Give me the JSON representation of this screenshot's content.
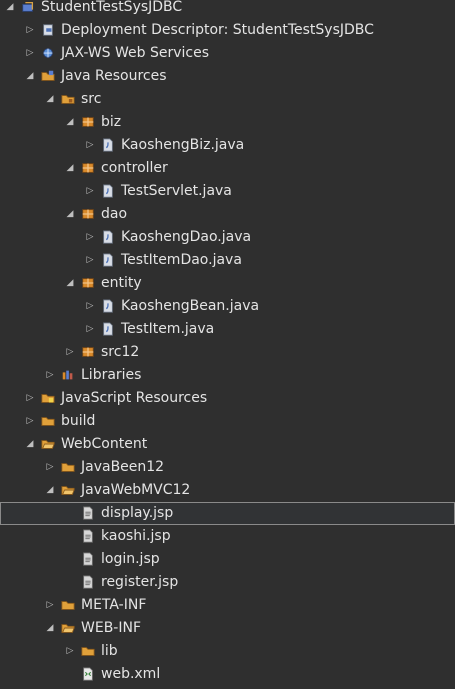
{
  "colors": {
    "background": "#2f2f2f",
    "text": "#e4e4e4",
    "selection_border": "#8a8a8a",
    "folder": "#e0a03a",
    "package": "#d98a2b",
    "java_file": "#d8dde6",
    "jsp_file": "#d7d7d7",
    "xml_file": "#e9e9e9"
  },
  "project_tree": {
    "items": [
      {
        "label": "StudentTestSysJDBC",
        "level": 0,
        "state": "expanded",
        "icon": "project-icon"
      },
      {
        "label": "Deployment Descriptor: StudentTestSysJDBC",
        "level": 1,
        "state": "collapsed",
        "icon": "deployment-descriptor-icon"
      },
      {
        "label": "JAX-WS Web Services",
        "level": 1,
        "state": "collapsed",
        "icon": "web-services-icon"
      },
      {
        "label": "Java Resources",
        "level": 1,
        "state": "expanded",
        "icon": "java-resources-icon"
      },
      {
        "label": "src",
        "level": 2,
        "state": "expanded",
        "icon": "source-folder-icon"
      },
      {
        "label": "biz",
        "level": 3,
        "state": "expanded",
        "icon": "package-icon"
      },
      {
        "label": "KaoshengBiz.java",
        "level": 4,
        "state": "collapsed",
        "icon": "java-file-icon"
      },
      {
        "label": "controller",
        "level": 3,
        "state": "expanded",
        "icon": "package-icon"
      },
      {
        "label": "TestServlet.java",
        "level": 4,
        "state": "collapsed",
        "icon": "java-file-icon"
      },
      {
        "label": "dao",
        "level": 3,
        "state": "expanded",
        "icon": "package-icon"
      },
      {
        "label": "KaoshengDao.java",
        "level": 4,
        "state": "collapsed",
        "icon": "java-file-icon"
      },
      {
        "label": "TestItemDao.java",
        "level": 4,
        "state": "collapsed",
        "icon": "java-file-icon"
      },
      {
        "label": "entity",
        "level": 3,
        "state": "expanded",
        "icon": "package-icon"
      },
      {
        "label": "KaoshengBean.java",
        "level": 4,
        "state": "collapsed",
        "icon": "java-file-icon"
      },
      {
        "label": "TestItem.java",
        "level": 4,
        "state": "collapsed",
        "icon": "java-file-icon"
      },
      {
        "label": "src12",
        "level": 3,
        "state": "collapsed",
        "icon": "package-icon"
      },
      {
        "label": "Libraries",
        "level": 2,
        "state": "collapsed",
        "icon": "libraries-icon"
      },
      {
        "label": "JavaScript Resources",
        "level": 1,
        "state": "collapsed",
        "icon": "javascript-resources-icon"
      },
      {
        "label": "build",
        "level": 1,
        "state": "collapsed",
        "icon": "folder-icon"
      },
      {
        "label": "WebContent",
        "level": 1,
        "state": "expanded",
        "icon": "folder-open-icon"
      },
      {
        "label": "JavaBeen12",
        "level": 2,
        "state": "collapsed",
        "icon": "folder-icon"
      },
      {
        "label": "JavaWebMVC12",
        "level": 2,
        "state": "expanded",
        "icon": "folder-open-icon"
      },
      {
        "label": "display.jsp",
        "level": 3,
        "state": "leaf",
        "icon": "jsp-file-icon",
        "selected": true
      },
      {
        "label": "kaoshi.jsp",
        "level": 3,
        "state": "leaf",
        "icon": "jsp-file-icon"
      },
      {
        "label": "login.jsp",
        "level": 3,
        "state": "leaf",
        "icon": "jsp-file-icon"
      },
      {
        "label": "register.jsp",
        "level": 3,
        "state": "leaf",
        "icon": "jsp-file-icon"
      },
      {
        "label": "META-INF",
        "level": 2,
        "state": "collapsed",
        "icon": "folder-icon"
      },
      {
        "label": "WEB-INF",
        "level": 2,
        "state": "expanded",
        "icon": "folder-open-icon"
      },
      {
        "label": "lib",
        "level": 3,
        "state": "collapsed",
        "icon": "folder-icon"
      },
      {
        "label": "web.xml",
        "level": 3,
        "state": "leaf",
        "icon": "xml-file-icon"
      }
    ]
  }
}
